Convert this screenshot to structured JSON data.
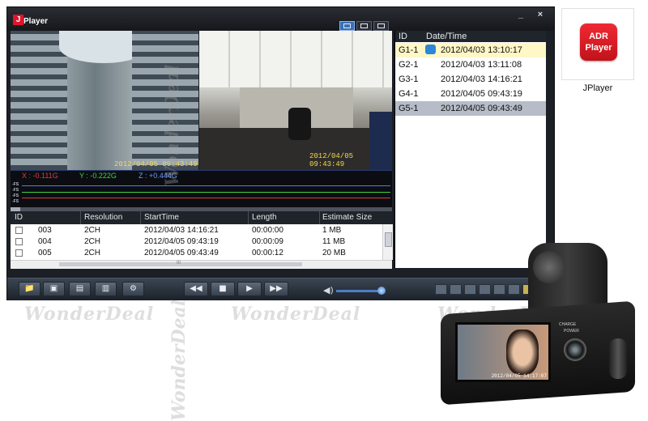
{
  "app": {
    "title": "Player",
    "logo_letter": "J"
  },
  "window_controls": {
    "minimize": "_",
    "close": "×"
  },
  "videos": [
    {
      "timestamp": "2012/04/05   09:43:49"
    },
    {
      "timestamp": "2012/04/05   09:43:49"
    }
  ],
  "gsensor": {
    "x_label": "X : -0.111G",
    "y_label": "Y : -0.222G",
    "z_label": "Z : +0.444G",
    "colors": {
      "x": "#e23b3b",
      "y": "#3fd03f",
      "z": "#4f7fe6"
    },
    "tick_labels": [
      "-FS",
      "-FS",
      "-FS",
      "-FS"
    ]
  },
  "id_list": {
    "headers": [
      "ID",
      "Date/Time"
    ],
    "rows": [
      {
        "id": "G1-1",
        "datetime": "2012/04/03  13:10:17",
        "selected": "yellow",
        "icon": "sync-icon"
      },
      {
        "id": "G2-1",
        "datetime": "2012/04/03  13:11:08"
      },
      {
        "id": "G3-1",
        "datetime": "2012/04/03  14:16:21"
      },
      {
        "id": "G4-1",
        "datetime": "2012/04/05  09:43:19"
      },
      {
        "id": "G5-1",
        "datetime": "2012/04/05  09:43:49",
        "selected": "gray"
      }
    ]
  },
  "file_table": {
    "headers": [
      "ID",
      "Resolution",
      "StartTime",
      "Length",
      "Estimate Size"
    ],
    "rows": [
      {
        "id": "003",
        "resolution": "2CH",
        "start": "2012/04/03 14:16:21",
        "length": "00:00:00",
        "size": "1 MB"
      },
      {
        "id": "004",
        "resolution": "2CH",
        "start": "2012/04/05 09:43:19",
        "length": "00:00:09",
        "size": "11 MB"
      },
      {
        "id": "005",
        "resolution": "2CH",
        "start": "2012/04/05 09:43:49",
        "length": "00:00:12",
        "size": "20 MB"
      }
    ],
    "hscroll_mark": "III"
  },
  "toolbar": {
    "file_buttons": [
      "folder-icon",
      "camera-icon",
      "save-icon",
      "delete-icon",
      "settings-icon"
    ],
    "playback": {
      "rewind": "◀◀",
      "stop": "■",
      "play": "▶",
      "forward": "▶▶"
    },
    "volume_icon": "◀)",
    "volume_level": 0.9
  },
  "side_app": {
    "icon_line1": "ADR",
    "icon_line2": "Player",
    "label": "JPlayer"
  },
  "watermark": {
    "text": "WonderDeal"
  },
  "device": {
    "screen_time": "2012/04/05 14:17:07",
    "label_left": "CHARGE",
    "label_right": "POWER"
  }
}
